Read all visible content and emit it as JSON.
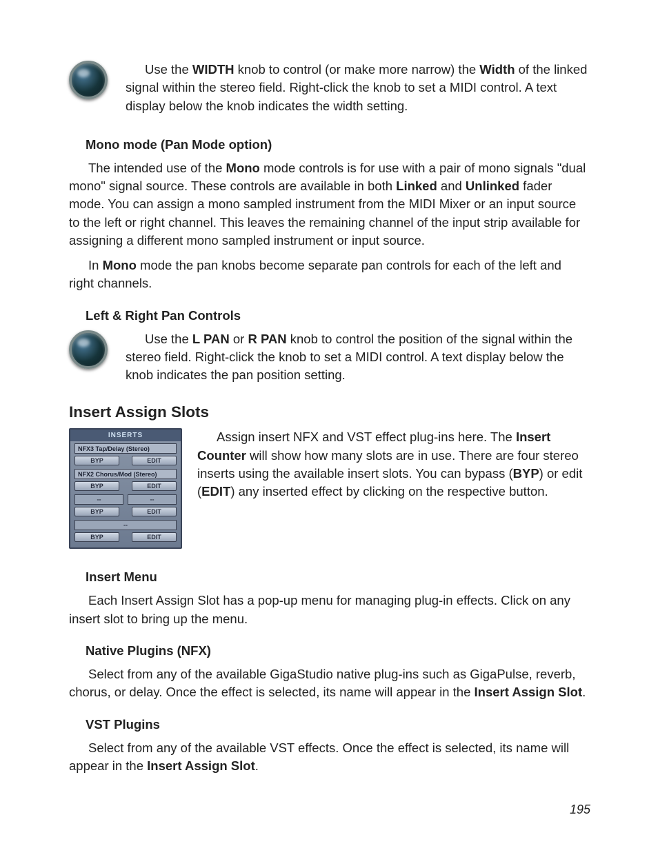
{
  "width_knob": {
    "para": "Use the WIDTH knob to control (or make more narrow) the Width of the linked signal within the stereo field. Right-click the knob to set a MIDI control. A text display below the knob indicates the width setting."
  },
  "mono_mode": {
    "heading": "Mono mode (Pan Mode option)",
    "para1": "The intended use of the Mono mode controls is for use with a pair of mono signals \"dual mono\" signal source.  These controls are available in both Linked and Unlinked fader mode. You can assign a mono sampled instrument from the MIDI Mixer or an input source to the left or right channel. This leaves the remaining channel of the input strip available for assigning a different mono sampled instrument or input source.",
    "para2": "In Mono mode the pan knobs become separate pan controls for each of the left and right channels."
  },
  "lr_pan": {
    "heading": "Left & Right Pan Controls",
    "para": "Use the L PAN or R PAN knob to control  the position of the signal within the stereo field. Right-click the knob to set a MIDI control. A text display below the knob indicates the pan position setting."
  },
  "insert_assign": {
    "heading": "Insert Assign Slots",
    "para": "Assign insert NFX and VST effect plug-ins here. The Insert Counter will show how many slots are in use. There are four stereo inserts using the available insert slots.  You can bypass (BYP) or edit (EDIT) any inserted effect by clicking on the respective button."
  },
  "inserts_panel": {
    "title": "INSERTS",
    "slots": [
      {
        "label": "NFX3 Tap/Delay (Stereo)",
        "byp": "BYP",
        "edit": "EDIT"
      },
      {
        "label": "NFX2 Chorus/Mod (Stereo)",
        "byp": "BYP",
        "edit": "EDIT"
      },
      {
        "label": "",
        "byp": "BYP",
        "edit": "EDIT"
      },
      {
        "label": "",
        "byp": "BYP",
        "edit": "EDIT"
      }
    ]
  },
  "insert_menu": {
    "heading": "Insert Menu",
    "para": "Each Insert Assign Slot has a pop-up menu for managing plug-in effects. Click on any insert slot to bring up the menu."
  },
  "native_plugins": {
    "heading": "Native Plugins (NFX)",
    "para": "Select from any of the available GigaStudio native plug-ins such as GigaPulse, reverb, chorus, or delay. Once the effect is selected, its name will appear in the Insert Assign Slot."
  },
  "vst_plugins": {
    "heading": "VST Plugins",
    "para": "Select from any of the available VST effects. Once the effect is selected, its name will appear in the Insert Assign Slot."
  },
  "page_number": "195"
}
